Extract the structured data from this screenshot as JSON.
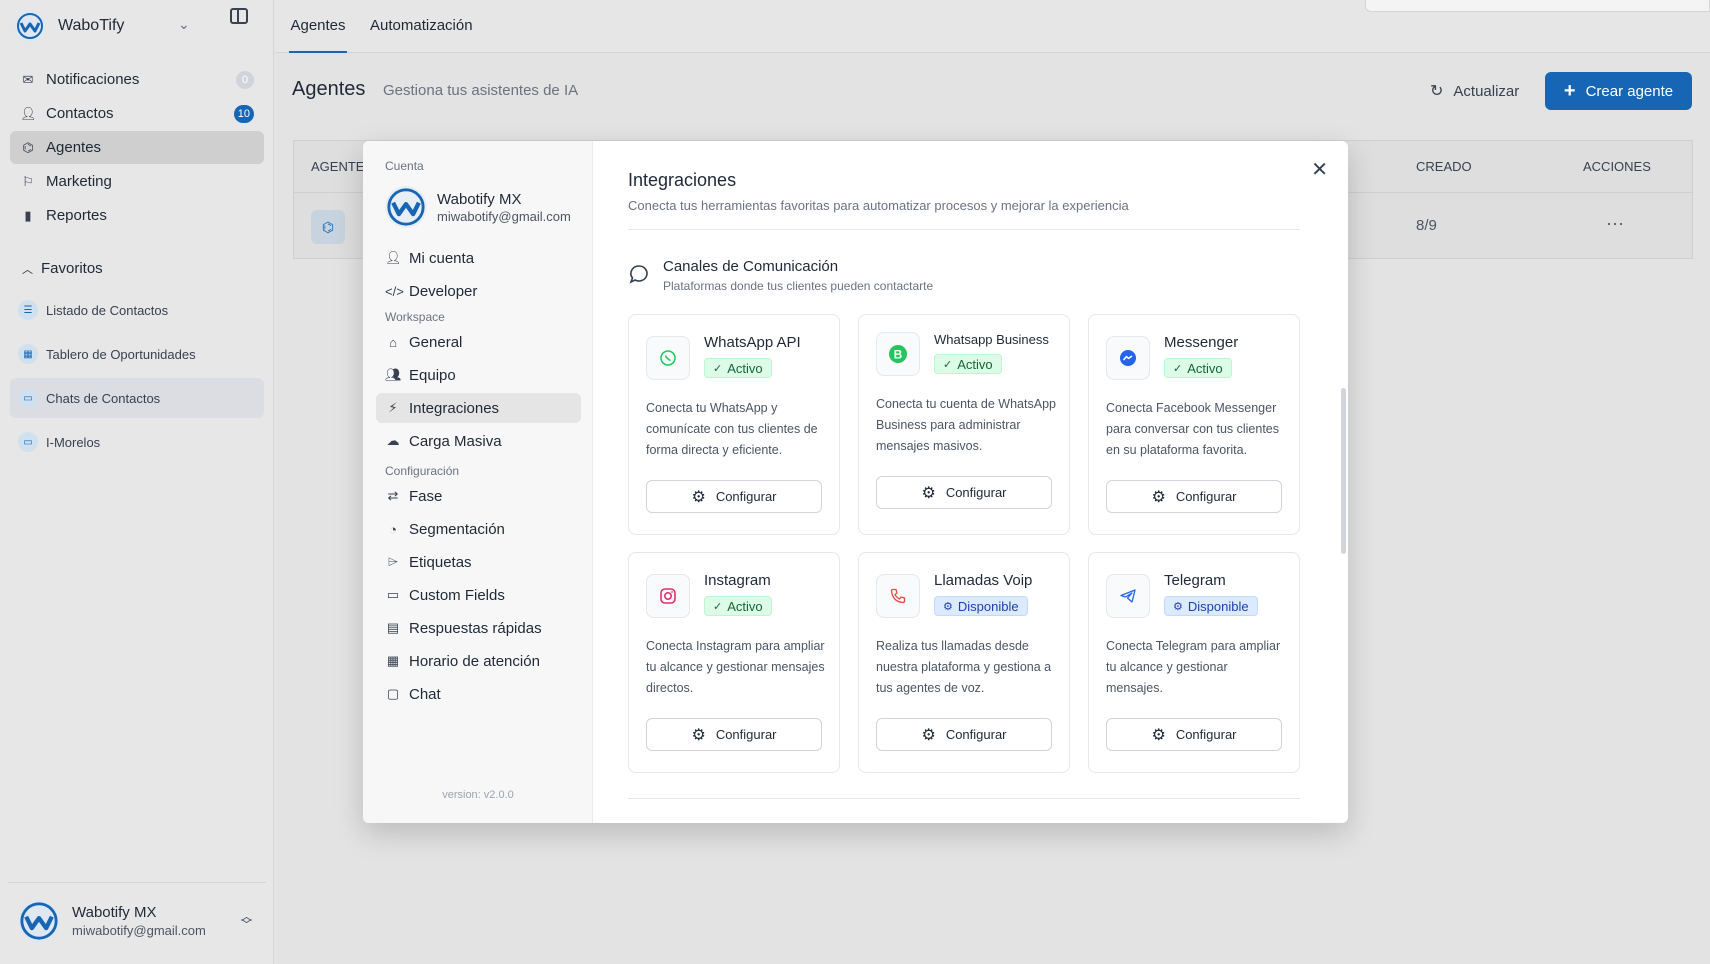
{
  "app": {
    "brand": "WaboTify",
    "nav": [
      {
        "label": "Notificaciones",
        "badge": "0"
      },
      {
        "label": "Contactos",
        "badge": "10"
      },
      {
        "label": "Agentes"
      },
      {
        "label": "Marketing"
      },
      {
        "label": "Reportes"
      }
    ],
    "favorites_title": "Favoritos",
    "favorites": [
      "Listado de Contactos",
      "Tablero de Oportunidades",
      "Chats de Contactos",
      "I-Morelos"
    ],
    "user": {
      "name": "Wabotify MX",
      "email": "miwabotify@gmail.com"
    }
  },
  "topbar": {
    "tabs": [
      "Agentes",
      "Automatización"
    ]
  },
  "page": {
    "title": "Agentes",
    "subtitle": "Gestiona tus asistentes de IA",
    "refresh": "Actualizar",
    "create": "Crear agente"
  },
  "table": {
    "headers": {
      "agent": "AGENTE",
      "created": "CREADO",
      "actions": "ACCIONES"
    },
    "row": {
      "created": "8/9",
      "actions": "···"
    }
  },
  "modal": {
    "sections": {
      "account": "Cuenta",
      "workspace": "Workspace",
      "config": "Configuración"
    },
    "account": {
      "name": "Wabotify MX",
      "email": "miwabotify@gmail.com"
    },
    "account_items": [
      "Mi cuenta",
      "Developer"
    ],
    "workspace_items": [
      "General",
      "Equipo",
      "Integraciones",
      "Carga Masiva"
    ],
    "config_items": [
      "Fase",
      "Segmentación",
      "Etiquetas",
      "Custom Fields",
      "Respuestas rápidas",
      "Horario de atención",
      "Chat"
    ],
    "version": "version: v2.0.0",
    "title": "Integraciones",
    "subtitle": "Conecta tus herramientas favoritas para automatizar procesos y mejorar la experiencia",
    "section_title": "Canales de Comunicación",
    "section_sub": "Plataformas donde tus clientes pueden contactarte",
    "configure": "Configurar",
    "cards": [
      {
        "name": "WhatsApp API",
        "status": "Activo",
        "desc": "Conecta tu WhatsApp y comunícate con tus clientes de forma directa y eficiente.",
        "icon": "whatsapp-icon",
        "color": "#22c55e"
      },
      {
        "name": "Whatsapp Business",
        "status": "Activo",
        "desc": "Conecta tu cuenta de WhatsApp Business para administrar mensajes masivos.",
        "icon": "whatsapp-business-icon",
        "color": "#22c55e"
      },
      {
        "name": "Messenger",
        "status": "Activo",
        "desc": "Conecta Facebook Messenger para conversar con tus clientes en su plataforma favorita.",
        "icon": "messenger-icon",
        "color": "#2563eb"
      },
      {
        "name": "Instagram",
        "status": "Activo",
        "desc": "Conecta Instagram para ampliar tu alcance y gestionar mensajes directos.",
        "icon": "instagram-icon",
        "color": "#e1306c"
      },
      {
        "name": "Llamadas Voip",
        "status": "Disponible",
        "desc": "Realiza tus llamadas desde nuestra plataforma y gestiona a tus agentes de voz.",
        "icon": "phone-icon",
        "color": "#ef4444"
      },
      {
        "name": "Telegram",
        "status": "Disponible",
        "desc": "Conecta Telegram para ampliar tu alcance y gestionar mensajes.",
        "icon": "telegram-icon",
        "color": "#2563eb"
      }
    ]
  },
  "colors": {
    "accent": "#1666b5",
    "active_badge": "#dcfce7",
    "available_badge": "#dbeafe"
  }
}
